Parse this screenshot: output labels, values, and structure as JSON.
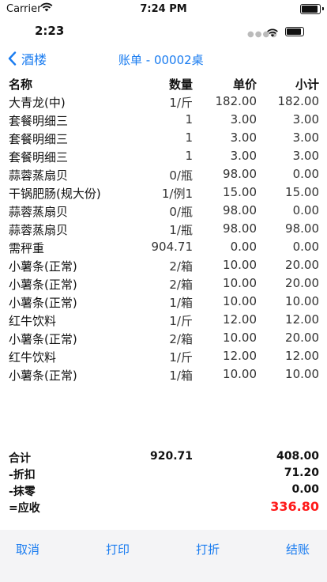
{
  "system_status": {
    "carrier": "Carrier",
    "time": "7:24 PM"
  },
  "app_status": {
    "time": "2:23"
  },
  "nav": {
    "back_label": "酒楼",
    "title": "账单 - 00002桌"
  },
  "table": {
    "headers": {
      "name": "名称",
      "qty": "数量",
      "price": "单价",
      "subtotal": "小计"
    },
    "rows": [
      {
        "name": "大青龙(中)",
        "qty": "1/斤",
        "price": "182.00",
        "subtotal": "182.00"
      },
      {
        "name": "套餐明细三",
        "qty": "1",
        "price": "3.00",
        "subtotal": "3.00"
      },
      {
        "name": "套餐明细三",
        "qty": "1",
        "price": "3.00",
        "subtotal": "3.00"
      },
      {
        "name": "套餐明细三",
        "qty": "1",
        "price": "3.00",
        "subtotal": "3.00"
      },
      {
        "name": "蒜蓉蒸扇贝",
        "qty": "0/瓶",
        "price": "98.00",
        "subtotal": "0.00"
      },
      {
        "name": "干锅肥肠(规大份)",
        "qty": "1/例1",
        "price": "15.00",
        "subtotal": "15.00"
      },
      {
        "name": "蒜蓉蒸扇贝",
        "qty": "0/瓶",
        "price": "98.00",
        "subtotal": "0.00"
      },
      {
        "name": "蒜蓉蒸扇贝",
        "qty": "1/瓶",
        "price": "98.00",
        "subtotal": "98.00"
      },
      {
        "name": "需秤重",
        "qty": "904.71",
        "price": "0.00",
        "subtotal": "0.00"
      },
      {
        "name": "小薯条(正常)",
        "qty": "2/箱",
        "price": "10.00",
        "subtotal": "20.00"
      },
      {
        "name": "小薯条(正常)",
        "qty": "2/箱",
        "price": "10.00",
        "subtotal": "20.00"
      },
      {
        "name": "小薯条(正常)",
        "qty": "1/箱",
        "price": "10.00",
        "subtotal": "10.00"
      },
      {
        "name": "红牛饮料",
        "qty": "1/斤",
        "price": "12.00",
        "subtotal": "12.00"
      },
      {
        "name": "小薯条(正常)",
        "qty": "2/箱",
        "price": "10.00",
        "subtotal": "20.00"
      },
      {
        "name": "红牛饮料",
        "qty": "1/斤",
        "price": "12.00",
        "subtotal": "12.00"
      },
      {
        "name": "小薯条(正常)",
        "qty": "1/箱",
        "price": "10.00",
        "subtotal": "10.00"
      }
    ]
  },
  "totals": {
    "total_label": "合计",
    "total_qty": "920.71",
    "total_value": "408.00",
    "discount_label": "-折扣",
    "discount_value": "71.20",
    "rounding_label": "-抹零",
    "rounding_value": "0.00",
    "due_label": "=应收",
    "due_value": "336.80"
  },
  "actions": {
    "cancel": "取消",
    "print": "打印",
    "discount": "打折",
    "checkout": "结账"
  },
  "colors": {
    "accent": "#1a7cf0",
    "amount_due": "#ff1a1a"
  },
  "icons": {
    "back": "chevron-left-icon",
    "wifi": "wifi-icon",
    "battery": "battery-icon"
  }
}
